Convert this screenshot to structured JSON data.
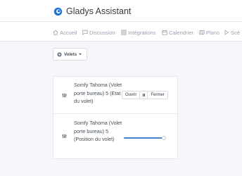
{
  "colors": {
    "brand": "#1d74d4",
    "accent": "#467fcf",
    "nav_text": "#9aa0ac",
    "background": "#f5f7fb"
  },
  "header": {
    "title": "Gladys Assistant",
    "logo_icon": "gladys-logo-icon"
  },
  "nav": {
    "items": [
      {
        "label": "Accueil",
        "icon": "home-icon"
      },
      {
        "label": "Discussion",
        "icon": "message-square-icon"
      },
      {
        "label": "Intégrations",
        "icon": "grid-icon"
      },
      {
        "label": "Calendrier",
        "icon": "calendar-icon"
      },
      {
        "label": "Plans",
        "icon": "map-icon"
      },
      {
        "label": "Scè",
        "icon": "play-icon"
      }
    ]
  },
  "room_select": {
    "value": "Volets",
    "icon": "room-icon"
  },
  "devices": [
    {
      "name": "Somfy Tahoma (Volet porte bureau) 5 (Etat du volet)",
      "icon": "sliders-icon",
      "control": {
        "type": "buttons",
        "open_label": "Ouvrir",
        "stop_label": "",
        "close_label": "Fermer"
      }
    },
    {
      "name": "Somfy Tahoma (Volet porte bureau) 5 (Position du volet)",
      "icon": "sliders-icon",
      "control": {
        "type": "slider",
        "value_percent": 95
      }
    }
  ]
}
